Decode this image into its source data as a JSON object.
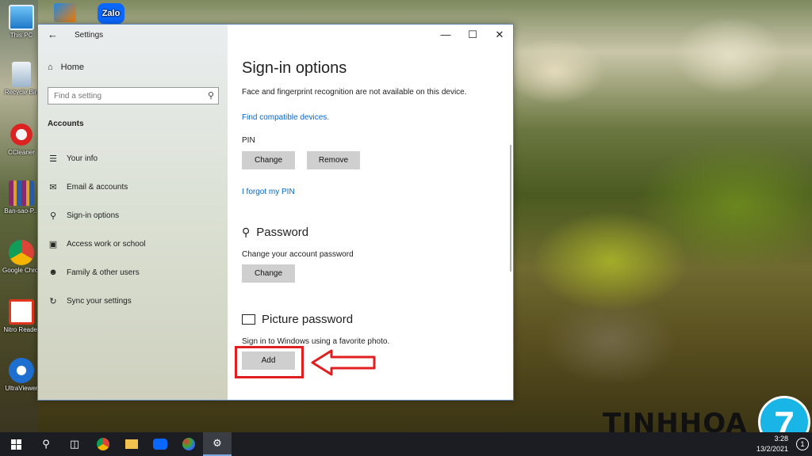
{
  "desktop": {
    "icons": [
      {
        "label": "This PC"
      },
      {
        "label": "Recycle Bin"
      },
      {
        "label": "CCleaner"
      },
      {
        "label": "Ban-sao-P..."
      },
      {
        "label": "Google Chrome"
      },
      {
        "label": "Nitro Reader"
      },
      {
        "label": "UltraViewer"
      }
    ],
    "top_icons": [
      {
        "label": ""
      },
      {
        "label": "Zalo"
      }
    ]
  },
  "window": {
    "title": "Settings",
    "controls": {
      "minimize": "—",
      "maximize": "☐",
      "close": "✕"
    },
    "sidebar": {
      "home_label": "Home",
      "search_placeholder": "Find a setting",
      "section_label": "Accounts",
      "items": [
        {
          "label": "Your info",
          "icon": "person-card-icon"
        },
        {
          "label": "Email & accounts",
          "icon": "mail-icon"
        },
        {
          "label": "Sign-in options",
          "icon": "key-icon"
        },
        {
          "label": "Access work or school",
          "icon": "briefcase-icon"
        },
        {
          "label": "Family & other users",
          "icon": "person-plus-icon"
        },
        {
          "label": "Sync your settings",
          "icon": "sync-icon"
        }
      ]
    },
    "content": {
      "title": "Sign-in options",
      "face_text": "Face and fingerprint recognition are not available on this device.",
      "compatible_link": "Find compatible devices.",
      "pin_label": "PIN",
      "pin_change": "Change",
      "pin_remove": "Remove",
      "forgot_pin": "I forgot my PIN",
      "password_title": "Password",
      "password_desc": "Change your account password",
      "password_change": "Change",
      "picture_title": "Picture password",
      "picture_desc": "Sign in to Windows using a favorite photo.",
      "picture_add": "Add"
    }
  },
  "watermark": {
    "text": "TINHHOA",
    "badge": "7"
  },
  "taskbar": {
    "time": "3:28",
    "date": "13/2/2021",
    "notification_count": "1"
  },
  "colors": {
    "accent": "#0a66c4",
    "highlight": "#e02020"
  }
}
